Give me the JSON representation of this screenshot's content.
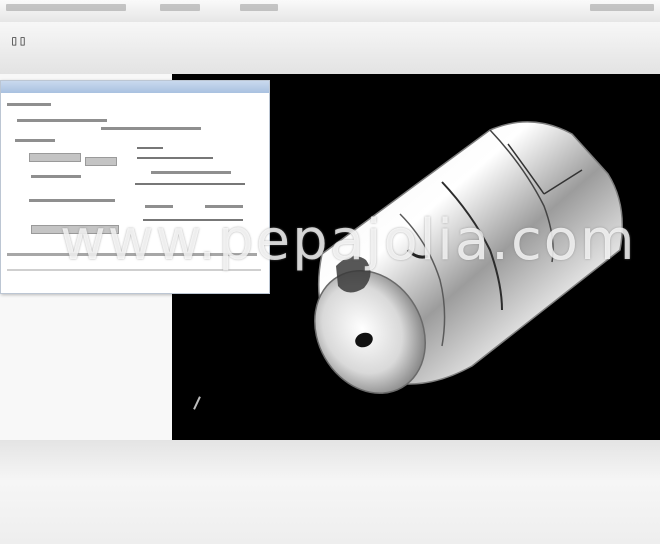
{
  "toolbar": {
    "app_icon_glyph": "▯▯"
  },
  "viewport": {
    "background": "#000000",
    "model": "cylindrical-metal-part"
  },
  "watermark": {
    "text": "www.pepajolia.com"
  },
  "colors": {
    "dialog_titlebar": "#a9c1e0",
    "viewport": "#000000"
  }
}
